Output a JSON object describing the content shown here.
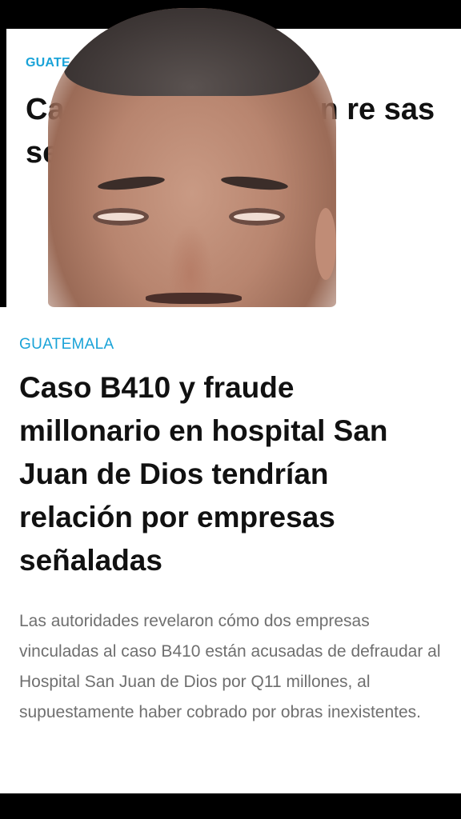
{
  "background_article": {
    "category_label": "GUATE",
    "title_text": "Ca e m ital San Ju ían re sas se"
  },
  "article": {
    "category": "GUATEMALA",
    "title": "Caso B410 y fraude millonario en hospital San Juan de Dios tendrían relación por empresas señaladas",
    "summary": "Las autoridades revelaron cómo dos empresas vinculadas al caso B410 están acusadas de defraudar al Hospital San Juan de Dios por Q11 millones, al supuestamente haber cobrado por obras inexistentes."
  },
  "colors": {
    "accent": "#1aa3d8",
    "title": "#111111",
    "summary": "#6f6f6f",
    "background": "#ffffff",
    "frame": "#000000"
  }
}
